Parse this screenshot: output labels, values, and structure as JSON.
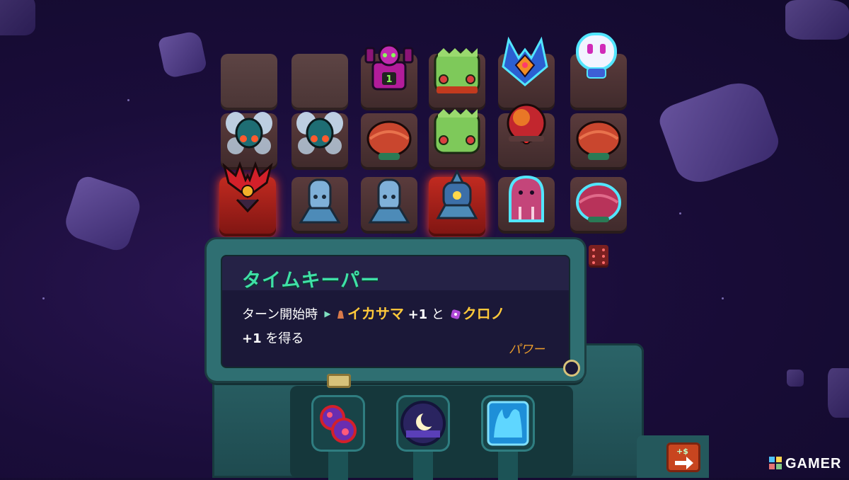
{
  "tooltip": {
    "title": "タイムキーパー",
    "desc_prefix": "ターン開始時",
    "keyword1": "イカサマ",
    "amount1": "+1",
    "conj": "と",
    "keyword2": "クロノ",
    "amount2": "+1",
    "desc_suffix": "を得る",
    "category": "パワー"
  },
  "board": {
    "columns": 6,
    "rows": 3,
    "badge_number": "1",
    "units": [
      {
        "row": 0,
        "col": 0,
        "kind": "empty-slot"
      },
      {
        "row": 0,
        "col": 1,
        "kind": "empty-slot"
      },
      {
        "row": 0,
        "col": 2,
        "kind": "magenta-robot"
      },
      {
        "row": 0,
        "col": 3,
        "kind": "green-bush"
      },
      {
        "row": 0,
        "col": 4,
        "kind": "winged-crest"
      },
      {
        "row": 0,
        "col": 5,
        "kind": "white-skull-bot"
      },
      {
        "row": 1,
        "col": 0,
        "kind": "cyan-fly"
      },
      {
        "row": 1,
        "col": 1,
        "kind": "cyan-fly"
      },
      {
        "row": 1,
        "col": 2,
        "kind": "orange-pod"
      },
      {
        "row": 1,
        "col": 3,
        "kind": "green-bush"
      },
      {
        "row": 1,
        "col": 4,
        "kind": "fire-orb"
      },
      {
        "row": 1,
        "col": 5,
        "kind": "orange-pod"
      },
      {
        "row": 2,
        "col": 0,
        "kind": "red-antler"
      },
      {
        "row": 2,
        "col": 1,
        "kind": "blue-turret"
      },
      {
        "row": 2,
        "col": 2,
        "kind": "blue-turret"
      },
      {
        "row": 2,
        "col": 3,
        "kind": "spike-turret"
      },
      {
        "row": 2,
        "col": 4,
        "kind": "pink-blob"
      },
      {
        "row": 2,
        "col": 5,
        "kind": "orange-pod"
      }
    ]
  },
  "abilities": [
    {
      "name": "dual-orbs-icon"
    },
    {
      "name": "moon-night-icon"
    },
    {
      "name": "blue-flame-icon"
    }
  ],
  "watermark": "GAMER",
  "colors": {
    "title": "#3fe0a6",
    "keyword": "#ffc93a",
    "category": "#f0a02c",
    "hot_slot": "#c12a20",
    "panel": "#2f6f72"
  }
}
